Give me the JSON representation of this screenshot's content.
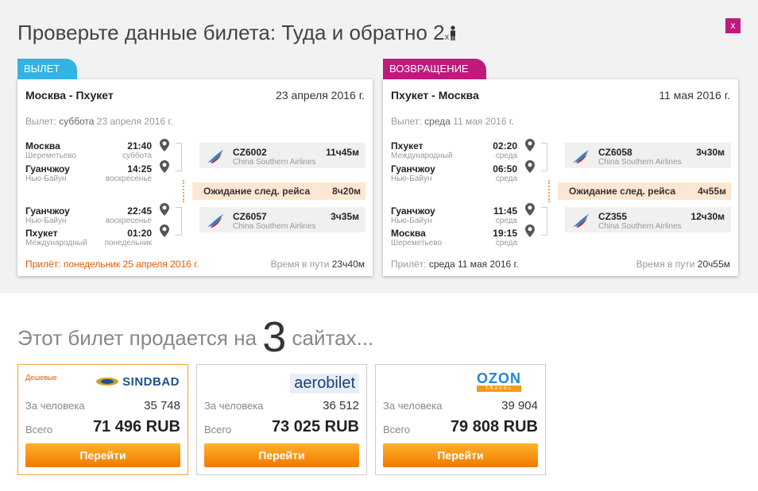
{
  "header": {
    "title": "Проверьте данные билета:",
    "trip_type": "Туда и обратно",
    "passengers": "2",
    "passengers_suffix": "x",
    "close_label": "x"
  },
  "outbound": {
    "tag": "ВЫЛЕТ",
    "route": "Москва - Пхукет",
    "date": "23 апреля 2016 г.",
    "departure_prefix": "Вылет:",
    "departure_day": "суббота",
    "departure_date": "23 апреля 2016 г.",
    "segments": [
      {
        "from_city": "Москва",
        "from_airport": "Шереметьево",
        "dep_time": "21:40",
        "dep_day": "суббота",
        "to_city": "Гуанчжоу",
        "to_airport": "Нью-Байун",
        "arr_time": "14:25",
        "arr_day": "воскресенье",
        "flight": "CZ6002",
        "airline": "China Southern Airlines",
        "duration": "11ч45м"
      },
      {
        "from_city": "Гуанчжоу",
        "from_airport": "Нью-Байун",
        "dep_time": "22:45",
        "dep_day": "воскресенье",
        "to_city": "Пхукет",
        "to_airport": "Международный",
        "arr_time": "01:20",
        "arr_day": "понедельник",
        "flight": "CZ6057",
        "airline": "China Southern Airlines",
        "duration": "3ч35м"
      }
    ],
    "layover_label": "Ожидание след. рейса",
    "layover_duration": "8ч20м",
    "arrival_text": "Прилёт: понедельник 25 апреля 2016 г.",
    "travel_label": "Время в пути",
    "travel_time": "23ч40м"
  },
  "inbound": {
    "tag": "ВОЗВРАЩЕНИЕ",
    "route": "Пхукет - Москва",
    "date": "11 мая 2016 г.",
    "departure_prefix": "Вылет:",
    "departure_day": "среда",
    "departure_date": "11 мая 2016 г.",
    "segments": [
      {
        "from_city": "Пхукет",
        "from_airport": "Международный",
        "dep_time": "02:20",
        "dep_day": "среда",
        "to_city": "Гуанчжоу",
        "to_airport": "Нью-Байун",
        "arr_time": "06:50",
        "arr_day": "среда",
        "flight": "CZ6058",
        "airline": "China Southern Airlines",
        "duration": "3ч30м"
      },
      {
        "from_city": "Гуанчжоу",
        "from_airport": "Нью-Байун",
        "dep_time": "11:45",
        "dep_day": "среда",
        "to_city": "Москва",
        "to_airport": "Шереметьево",
        "arr_time": "19:15",
        "arr_day": "среда",
        "flight": "CZ355",
        "airline": "China Southern Airlines",
        "duration": "12ч30м"
      }
    ],
    "layover_label": "Ожидание след. рейса",
    "layover_duration": "4ч55м",
    "arrival_prefix": "Прилёт:",
    "arrival_day_date": "среда 11 мая 2016 г.",
    "travel_label": "Время в пути",
    "travel_time": "20ч55м"
  },
  "sold": {
    "prefix": "Этот билет продается на",
    "count": "3",
    "suffix": "сайтах..."
  },
  "sites": [
    {
      "name": "SINDBAD",
      "badge": "Дешевые",
      "per_person_label": "За человека",
      "per_person": "35 748",
      "total_label": "Всего",
      "total": "71 496 RUB",
      "button": "Перейти"
    },
    {
      "name": "aerobilet",
      "per_person_label": "За человека",
      "per_person": "36 512",
      "total_label": "Всего",
      "total": "73 025 RUB",
      "button": "Перейти"
    },
    {
      "name": "OZON",
      "name_sub": "TRAVEL",
      "per_person_label": "За человека",
      "per_person": "39 904",
      "total_label": "Всего",
      "total": "79 808 RUB",
      "button": "Перейти"
    }
  ],
  "colors": {
    "accent_blue": "#33b3e3",
    "accent_magenta": "#c0197d",
    "button_orange": "#f59a10"
  },
  "icons": [
    "person-icon",
    "close-icon",
    "map-pin-icon",
    "china-southern-logo-icon"
  ]
}
